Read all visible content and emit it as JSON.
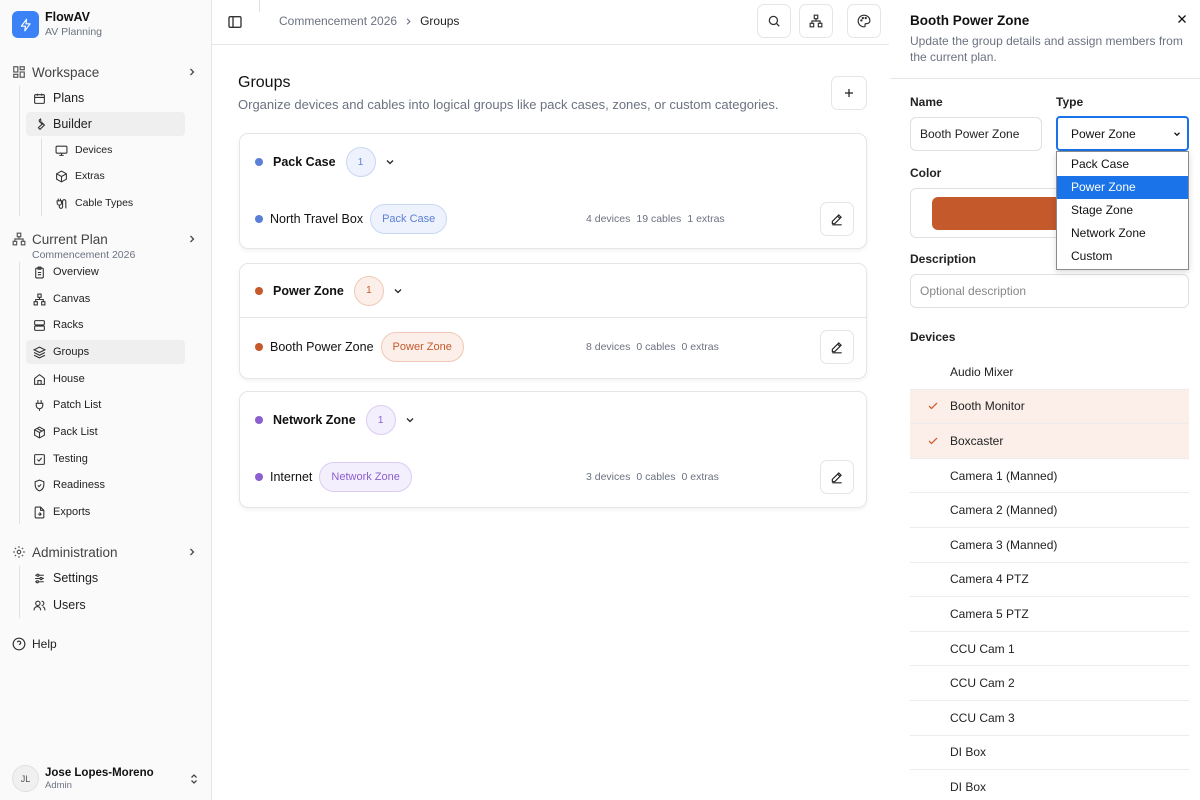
{
  "app": {
    "name": "FlowAV",
    "subtitle": "AV Planning"
  },
  "sidebar": {
    "workspace": {
      "label": "Workspace",
      "items": [
        {
          "label": "Plans",
          "icon": "calendar-icon"
        },
        {
          "label": "Builder",
          "icon": "wrench-icon"
        }
      ],
      "builder_items": [
        {
          "label": "Devices",
          "icon": "monitor-icon"
        },
        {
          "label": "Extras",
          "icon": "box-icon"
        },
        {
          "label": "Cable Types",
          "icon": "cable-icon"
        }
      ]
    },
    "current_plan": {
      "label": "Current Plan",
      "sublabel": "Commencement 2026",
      "items": [
        {
          "label": "Overview",
          "icon": "clipboard-icon"
        },
        {
          "label": "Canvas",
          "icon": "network-icon"
        },
        {
          "label": "Racks",
          "icon": "server-icon"
        },
        {
          "label": "Groups",
          "icon": "layers-icon"
        },
        {
          "label": "House",
          "icon": "house-icon"
        },
        {
          "label": "Patch List",
          "icon": "plug-icon"
        },
        {
          "label": "Pack List",
          "icon": "package-icon"
        },
        {
          "label": "Testing",
          "icon": "checkbox-icon"
        },
        {
          "label": "Readiness",
          "icon": "shield-check-icon"
        },
        {
          "label": "Exports",
          "icon": "export-icon"
        }
      ]
    },
    "administration": {
      "label": "Administration",
      "items": [
        {
          "label": "Settings",
          "icon": "sliders-icon"
        },
        {
          "label": "Users",
          "icon": "users-icon"
        }
      ]
    },
    "help": "Help",
    "user": {
      "initials": "JL",
      "name": "Jose Lopes-Moreno",
      "role": "Admin"
    }
  },
  "breadcrumb": {
    "parent": "Commencement 2026",
    "current": "Groups"
  },
  "main": {
    "title": "Groups",
    "description": "Organize devices and cables into logical groups like pack cases, zones, or custom categories.",
    "groups": [
      {
        "title": "Pack Case",
        "count": "1",
        "color": "#5b7fd6",
        "rows": [
          {
            "name": "North Travel Box",
            "tag": "Pack Case",
            "devices": "4 devices",
            "cables": "19 cables",
            "extras": "1 extras"
          }
        ]
      },
      {
        "title": "Power Zone",
        "count": "1",
        "color": "#c45a2c",
        "rows": [
          {
            "name": "Booth Power Zone",
            "tag": "Power Zone",
            "devices": "8 devices",
            "cables": "0 cables",
            "extras": "0 extras"
          }
        ]
      },
      {
        "title": "Network Zone",
        "count": "1",
        "color": "#8b5fcf",
        "rows": [
          {
            "name": "Internet",
            "tag": "Network Zone",
            "devices": "3 devices",
            "cables": "0 cables",
            "extras": "0 extras"
          }
        ]
      }
    ]
  },
  "panel": {
    "title": "Booth Power Zone",
    "description": "Update the group details and assign members from the current plan.",
    "name_label": "Name",
    "name_value": "Booth Power Zone",
    "type_label": "Type",
    "type_value": "Power Zone",
    "type_options": [
      "Pack Case",
      "Power Zone",
      "Stage Zone",
      "Network Zone",
      "Custom"
    ],
    "color_label": "Color",
    "color_value": "#c45a2c",
    "description_label": "Description",
    "description_placeholder": "Optional description",
    "devices_label": "Devices",
    "devices": [
      {
        "name": "Audio Mixer",
        "checked": false
      },
      {
        "name": "Booth Monitor",
        "checked": true
      },
      {
        "name": "Boxcaster",
        "checked": true
      },
      {
        "name": "Camera 1 (Manned)",
        "checked": false
      },
      {
        "name": "Camera 2 (Manned)",
        "checked": false
      },
      {
        "name": "Camera 3 (Manned)",
        "checked": false
      },
      {
        "name": "Camera 4 PTZ",
        "checked": false
      },
      {
        "name": "Camera 5 PTZ",
        "checked": false
      },
      {
        "name": "CCU Cam 1",
        "checked": false
      },
      {
        "name": "CCU Cam 2",
        "checked": false
      },
      {
        "name": "CCU Cam 3",
        "checked": false
      },
      {
        "name": "DI Box",
        "checked": false
      },
      {
        "name": "DI Box",
        "checked": false
      }
    ]
  }
}
